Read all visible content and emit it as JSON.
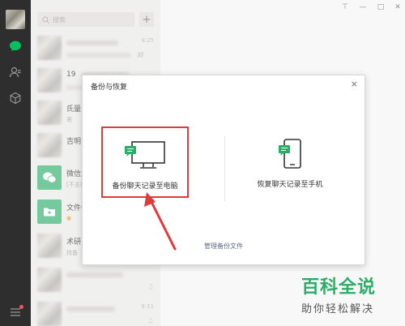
{
  "search": {
    "placeholder": "搜索",
    "add_label": "+"
  },
  "chats": [
    {
      "name": "",
      "sub": ":好",
      "time": "9:25",
      "blur": true
    },
    {
      "name": "19",
      "sub": "",
      "time": "",
      "blur": true
    },
    {
      "name": "氏量",
      "sub": "寄",
      "time": "",
      "blur": true
    },
    {
      "name": "吉明",
      "sub": "",
      "time": "",
      "blur": true
    },
    {
      "name": "微信运",
      "sub": "[不支持",
      "time": "",
      "blur": false,
      "icon": "wechat-bubble-icon"
    },
    {
      "name": "文件传",
      "sub": "",
      "time": "",
      "blur": false,
      "icon": "folder-icon"
    },
    {
      "name": "术研",
      "sub": "持备",
      "time": "",
      "blur": true
    },
    {
      "name": "",
      "sub": "",
      "time": "",
      "blur": true
    },
    {
      "name": "",
      "sub": "",
      "time": "9:11",
      "blur": true
    }
  ],
  "window": {
    "pin": "⊤",
    "minimize": "—",
    "maximize": "□",
    "close": "✕"
  },
  "dialog": {
    "title": "备份与恢复",
    "close": "×",
    "backup_label": "备份聊天记录至电脑",
    "restore_label": "恢复聊天记录至手机",
    "manage_link": "管理备份文件"
  },
  "watermark": {
    "title": "百科全说",
    "subtitle": "助你轻松解决"
  },
  "colors": {
    "accent": "#2aae67",
    "highlight": "#e03a3a",
    "nav": "#2e2e2e"
  }
}
